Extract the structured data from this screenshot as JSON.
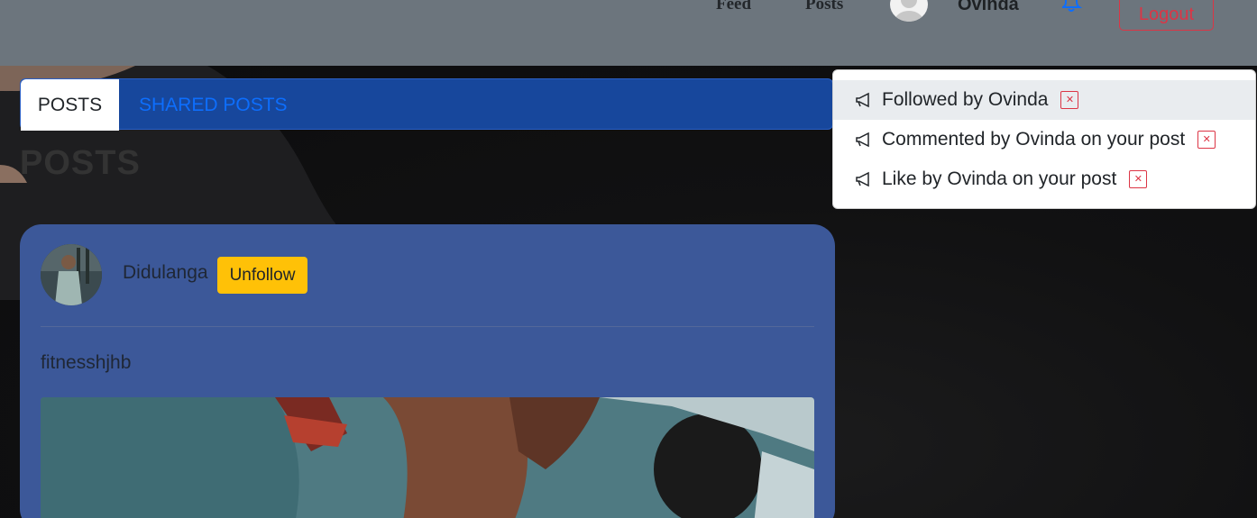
{
  "navbar": {
    "links": [
      "Feed",
      "Posts"
    ],
    "username": "Ovinda",
    "logout_label": "Logout"
  },
  "tabs": [
    {
      "label": "POSTS",
      "active": true
    },
    {
      "label": "SHARED POSTS",
      "active": false
    }
  ],
  "section_title": "POSTS",
  "post": {
    "author": "Didulanga",
    "follow_button": "Unfollow",
    "text": "fitnesshjhb"
  },
  "notifications": [
    {
      "text": "Followed by Ovinda",
      "active": true
    },
    {
      "text": "Commented by Ovinda on your post",
      "active": false
    },
    {
      "text": "Like by Ovinda on your post",
      "active": false
    }
  ],
  "icons": {
    "notification": "megaphone-icon",
    "nav": "bell-icon",
    "close": "close-icon"
  },
  "colors": {
    "navbar_bg": "#6c757d",
    "tab_bar_bg": "#17479c",
    "post_card_bg": "#3c5899",
    "accent_warning": "#ffc107",
    "danger": "#dc3545",
    "link_blue": "#0d6efd"
  }
}
